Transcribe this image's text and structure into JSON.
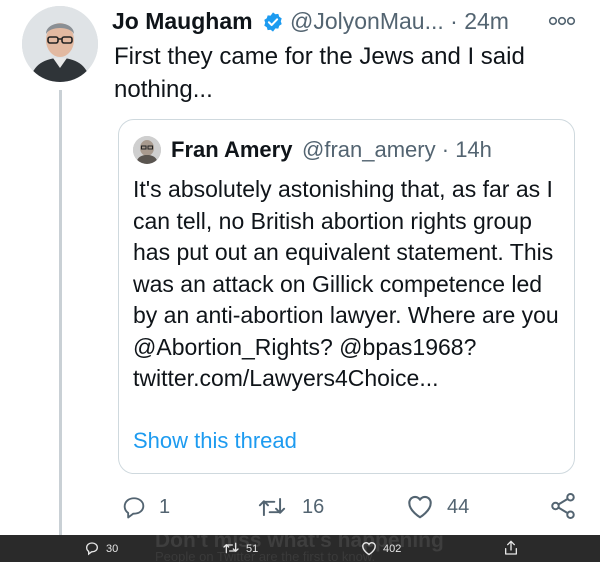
{
  "tweet": {
    "author_name": "Jo Maugham",
    "handle": "@JolyonMau...",
    "time": "24m",
    "text": "First they came for the Jews and I said nothing..."
  },
  "quoted_tweet": {
    "author_name": "Fran Amery",
    "handle": "@fran_amery",
    "time": "14h",
    "text": "It's absolutely astonishing that, as far as I can tell, no British abortion rights group has put out an equivalent statement. This was an attack on Gillick competence led by an anti-abortion lawyer. Where are you @Abortion_Rights? @bpas1968? twitter.com/Lawyers4Choice...",
    "show_thread_label": "Show this thread"
  },
  "actions": {
    "reply_count": "1",
    "retweet_count": "16",
    "like_count": "44"
  },
  "bottom_bar": {
    "overlay_title": "Don't miss what's happening",
    "overlay_subtitle": "People on Twitter are the first to know.",
    "reply_count": "30",
    "retweet_count": "51",
    "like_count": "402"
  },
  "colors": {
    "link": "#1d9bf0",
    "secondary_text": "#536471",
    "verified": "#1d9bf0",
    "bottom_bar": "#2a2a2a"
  }
}
